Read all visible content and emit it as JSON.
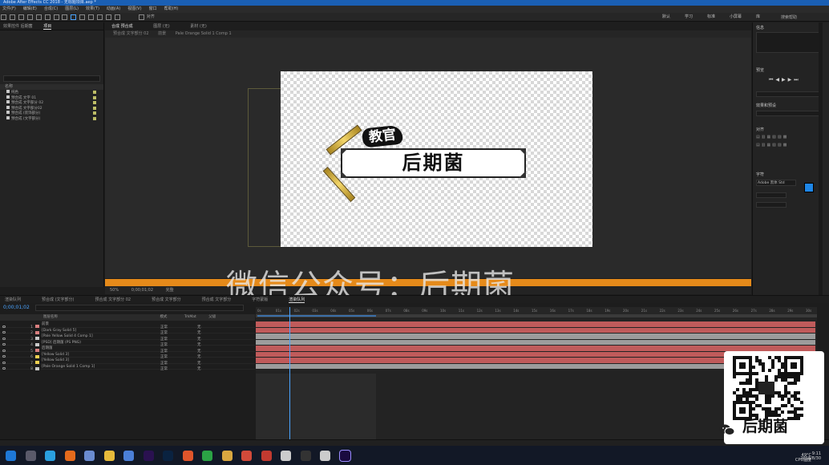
{
  "window": {
    "title": "Adobe After Effects CC 2018 - 无标题项目.aep *"
  },
  "menu": [
    "文件(F)",
    "编辑(E)",
    "合成(C)",
    "图层(L)",
    "效果(T)",
    "动画(A)",
    "视图(V)",
    "窗口",
    "帮助(H)"
  ],
  "toolbar": {
    "snap_label": "对齐",
    "workspaces": [
      "默认",
      "学习",
      "标准",
      "小屏幕",
      "库"
    ],
    "search_label": "搜索帮助"
  },
  "project": {
    "tabs": [
      "效果控件 后期菌",
      "项目"
    ],
    "column_name": "名称",
    "items": [
      "纯色",
      "预合成 文字 01",
      "预合成 文字部分 02",
      "预合成 文字部分02",
      "预合成 (装饰部分)",
      "预合成 (文字部分)"
    ]
  },
  "viewer": {
    "tabs": [
      "合成 预合成",
      "图层 (无)",
      "素材 (无)"
    ],
    "breadcrumbs": [
      "预合成 文字部分 02",
      "前景",
      "Pale Orange Solid 1 Comp 1"
    ],
    "zoom": "50%",
    "resolution": "完整",
    "timecode": "0;00;01;02"
  },
  "artwork": {
    "name_text": "后期菌",
    "badge_text": "教官"
  },
  "watermark": "微信公众号：后期菌",
  "right_panel": {
    "info_title": "信息",
    "preview_title": "预览",
    "effects_title": "效果和预设",
    "align_title": "对齐",
    "character_title": "字符",
    "font_name": "Adobe 黑体 Std"
  },
  "timeline": {
    "tabs": [
      "渲染队列",
      "预合成 (文字部分)",
      "预合成 文字部分 02",
      "预合成 文字部分",
      "预合成 文字部分",
      "字符蒙版",
      "渲染队列"
    ],
    "current_time": "0;00;01;02",
    "columns": {
      "name": "图层名称",
      "mode": "模式",
      "trkmat": "TrkMat",
      "parent": "父级"
    },
    "layers": [
      {
        "num": "1",
        "name": "前景",
        "color": "#d97f7f",
        "mode": "正常",
        "parent": "无"
      },
      {
        "num": "2",
        "name": "[Dark Gray Solid 5]",
        "color": "#d97f7f",
        "mode": "正常",
        "parent": "无"
      },
      {
        "num": "3",
        "name": "[Pale Yellow Solid 4 Comp 1]",
        "color": "#c9c9c9",
        "mode": "正常",
        "parent": "无"
      },
      {
        "num": "4",
        "name": "[PSD] 后期菌 (PS PNG)",
        "color": "#c9c9c9",
        "mode": "正常",
        "parent": "无"
      },
      {
        "num": "5",
        "name": "后期菌",
        "color": "#d97f7f",
        "mode": "正常",
        "parent": "无"
      },
      {
        "num": "6",
        "name": "[Yellow Solid 3]",
        "color": "#f0d050",
        "mode": "正常",
        "parent": "无"
      },
      {
        "num": "7",
        "name": "[Yellow Solid 3]",
        "color": "#f0d050",
        "mode": "正常",
        "parent": "无"
      },
      {
        "num": "8",
        "name": "[Pale Orange Solid 1 Comp 1]",
        "color": "#c9c9c9",
        "mode": "正常",
        "parent": "无"
      }
    ],
    "ruler": [
      "0s",
      "01s",
      "02s",
      "03s",
      "04s",
      "05s",
      "06s",
      "07s",
      "08s",
      "09s",
      "10s",
      "11s",
      "12s",
      "13s",
      "14s",
      "15s",
      "16s",
      "17s",
      "18s",
      "19s",
      "20s",
      "21s",
      "22s",
      "23s",
      "24s",
      "25s",
      "26s",
      "27s",
      "28s",
      "29s",
      "30s"
    ],
    "track_colors": [
      "#c05b5b",
      "#c05b5b",
      "#9c9c9c",
      "#9c9c9c",
      "#c05b5b",
      "#c05b5b",
      "#c05b5b",
      "#9c9c9c"
    ]
  },
  "taskbar": {
    "clock": "9:11",
    "date": "2018/8/30",
    "weather": "49°C",
    "cpu_label": "CPU温度"
  },
  "qr_brand": "后期菌"
}
